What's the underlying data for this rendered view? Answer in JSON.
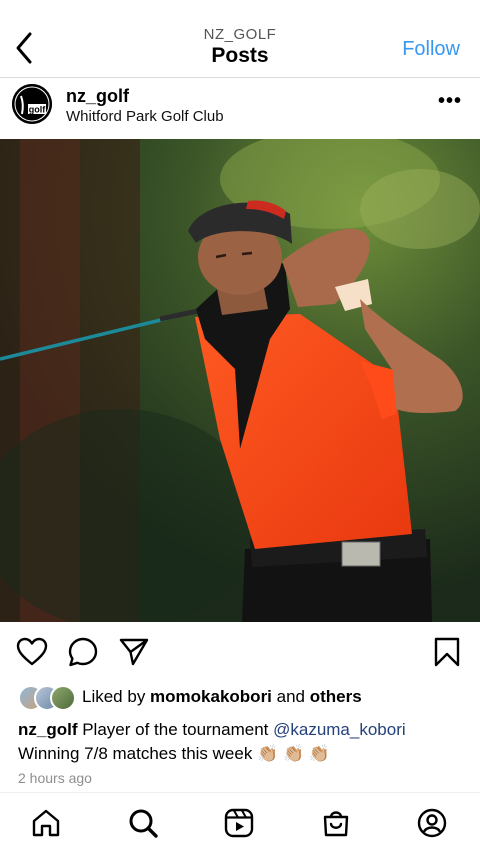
{
  "header": {
    "account": "NZ_GOLF",
    "title": "Posts",
    "follow_label": "Follow"
  },
  "post": {
    "username": "nz_golf",
    "location": "Whitford Park Golf Club",
    "more_label": "•••",
    "avatar_label": "golf"
  },
  "likes": {
    "prefix": "Liked by ",
    "user": "momokakobori",
    "middle": " and ",
    "others": "others"
  },
  "caption": {
    "username": "nz_golf",
    "text1": " Player of the tournament ",
    "mention": "@kazuma_kobori",
    "text2": "Winning 7/8 matches this week ",
    "emoji": "👏🏼 👏🏼 👏🏼"
  },
  "time": "2 hours ago",
  "icons": {
    "back": "chevron-left-icon",
    "like": "heart-icon",
    "comment": "comment-icon",
    "share": "send-icon",
    "save": "bookmark-icon",
    "tabs": [
      "home-icon",
      "search-icon",
      "reels-icon",
      "shop-icon",
      "profile-icon"
    ]
  },
  "colors": {
    "follow": "#3897f0",
    "mention": "#25417b",
    "shirt": "#ff4a1a"
  }
}
